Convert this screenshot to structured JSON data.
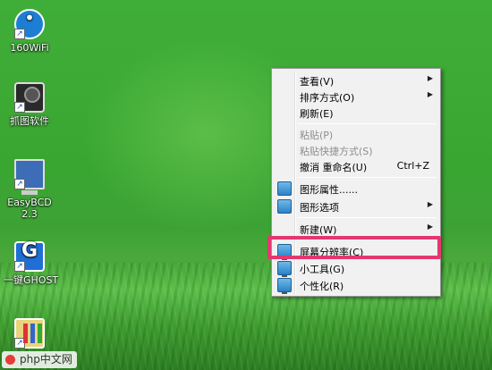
{
  "desktop": {
    "icons": [
      {
        "label": "160WiFi",
        "icon": "wifi-icon"
      },
      {
        "label": "抓图软件",
        "icon": "camera-icon"
      },
      {
        "label": "EasyBCD",
        "label2": "2.3",
        "icon": "computer-icon"
      },
      {
        "label": "一键GHOST",
        "icon": "ghost-icon"
      },
      {
        "label": "",
        "icon": "paint-icon"
      }
    ]
  },
  "context_menu": {
    "items": [
      {
        "label": "查看(V)",
        "submenu": true
      },
      {
        "label": "排序方式(O)",
        "submenu": true
      },
      {
        "label": "刷新(E)"
      },
      {
        "label": "粘贴(P)",
        "disabled": true
      },
      {
        "label": "粘贴快捷方式(S)",
        "disabled": true
      },
      {
        "label": "撤消 重命名(U)",
        "shortcut": "Ctrl+Z"
      },
      {
        "label": "图形属性......",
        "icon": "graphics-properties-icon"
      },
      {
        "label": "图形选项",
        "icon": "graphics-options-icon",
        "submenu": true
      },
      {
        "label": "新建(W)",
        "submenu": true
      },
      {
        "label": "屏幕分辨率(C)",
        "icon": "display-icon",
        "highlighted": true
      },
      {
        "label": "小工具(G)",
        "icon": "gadgets-icon"
      },
      {
        "label": "个性化(R)",
        "icon": "personalize-icon"
      }
    ],
    "submenu_arrow": "▶",
    "highlight_color": "#e4376f"
  },
  "watermark": {
    "text": "php中文网"
  }
}
